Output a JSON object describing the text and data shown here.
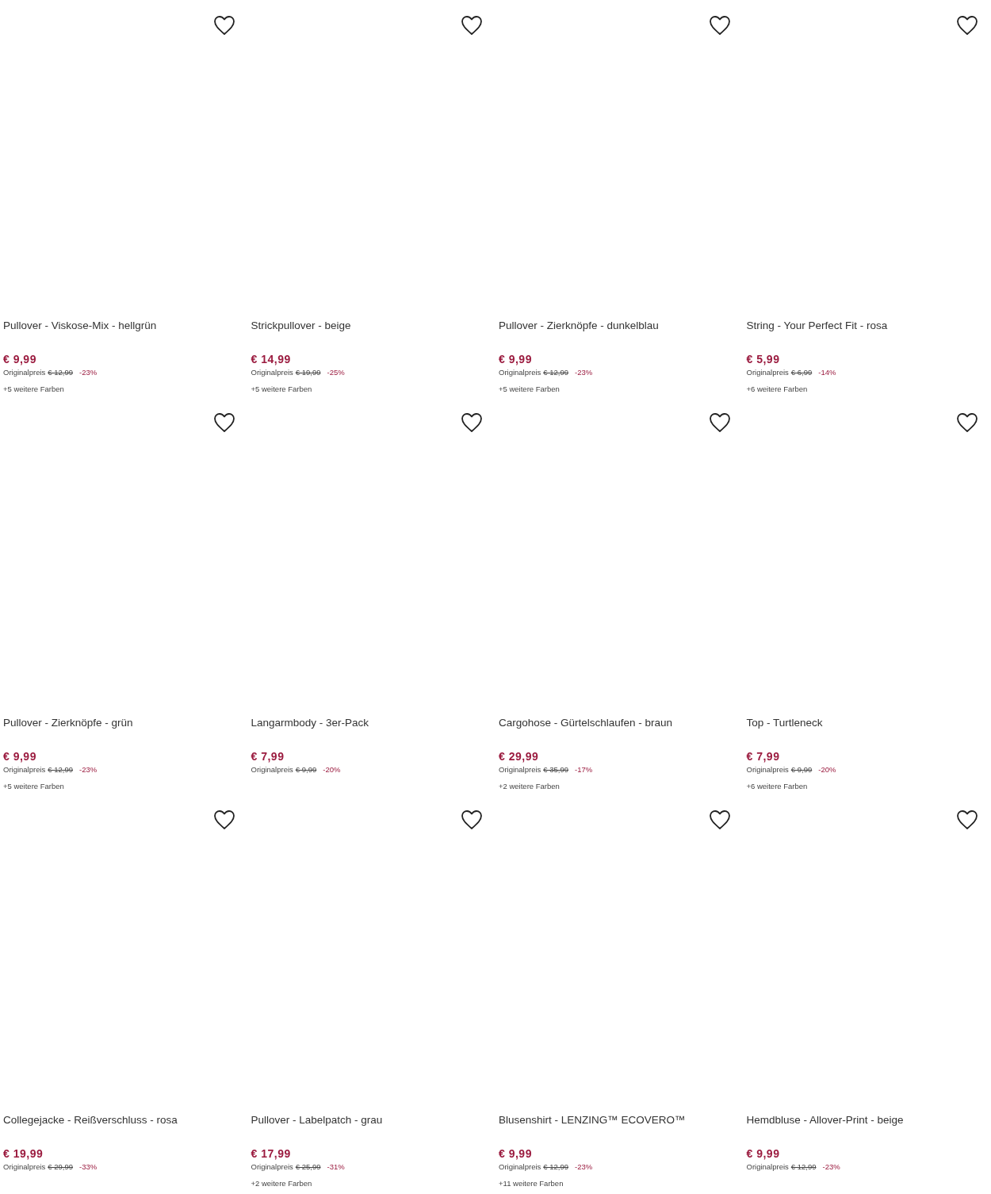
{
  "products": [
    {
      "title": "Pullover - Viskose-Mix - hellgrün",
      "price": "€ 9,99",
      "original_label": "Originalpreis",
      "original_price": "€ 12,99",
      "discount": "-23%",
      "more_colors": "+5 weitere Farben"
    },
    {
      "title": "Strickpullover - beige",
      "price": "€ 14,99",
      "original_label": "Originalpreis",
      "original_price": "€ 19,99",
      "discount": "-25%",
      "more_colors": "+5 weitere Farben"
    },
    {
      "title": "Pullover - Zierknöpfe - dunkelblau",
      "price": "€ 9,99",
      "original_label": "Originalpreis",
      "original_price": "€ 12,99",
      "discount": "-23%",
      "more_colors": "+5 weitere Farben"
    },
    {
      "title": "String - Your Perfect Fit - rosa",
      "price": "€ 5,99",
      "original_label": "Originalpreis",
      "original_price": "€ 6,99",
      "discount": "-14%",
      "more_colors": "+6 weitere Farben"
    },
    {
      "title": "Pullover - Zierknöpfe - grün",
      "price": "€ 9,99",
      "original_label": "Originalpreis",
      "original_price": "€ 12,99",
      "discount": "-23%",
      "more_colors": "+5 weitere Farben"
    },
    {
      "title": "Langarmbody - 3er-Pack",
      "price": "€ 7,99",
      "original_label": "Originalpreis",
      "original_price": "€ 9,99",
      "discount": "-20%"
    },
    {
      "title": "Cargohose - Gürtelschlaufen - braun",
      "price": "€ 29,99",
      "original_label": "Originalpreis",
      "original_price": "€ 35,99",
      "discount": "-17%",
      "more_colors": "+2 weitere Farben"
    },
    {
      "title": "Top - Turtleneck",
      "price": "€ 7,99",
      "original_label": "Originalpreis",
      "original_price": "€ 9,99",
      "discount": "-20%",
      "more_colors": "+6 weitere Farben"
    },
    {
      "title": "Collegejacke - Reißverschluss - rosa",
      "price": "€ 19,99",
      "original_label": "Originalpreis",
      "original_price": "€ 29,99",
      "discount": "-33%"
    },
    {
      "title": "Pullover - Labelpatch - grau",
      "price": "€ 17,99",
      "original_label": "Originalpreis",
      "original_price": "€ 25,99",
      "discount": "-31%",
      "more_colors": "+2 weitere Farben"
    },
    {
      "title": "Blusenshirt - LENZING™ ECOVERO™",
      "price": "€ 9,99",
      "original_label": "Originalpreis",
      "original_price": "€ 12,99",
      "discount": "-23%",
      "more_colors": "+11 weitere Farben"
    },
    {
      "title": "Hemdbluse - Allover-Print - beige",
      "price": "€ 9,99",
      "original_label": "Originalpreis",
      "original_price": "€ 12,99",
      "discount": "-23%"
    }
  ]
}
